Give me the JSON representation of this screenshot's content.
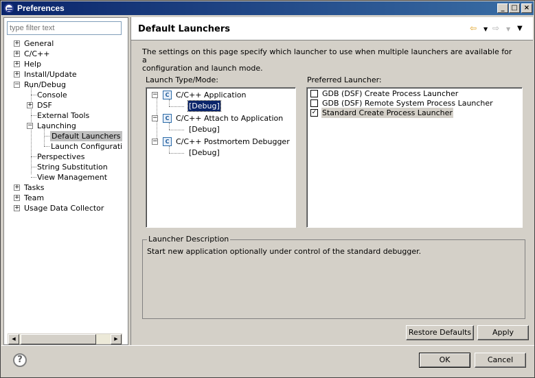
{
  "window": {
    "title": "Preferences"
  },
  "filter": {
    "placeholder": "type filter text"
  },
  "tree": {
    "items": [
      {
        "label": "General"
      },
      {
        "label": "C/C++"
      },
      {
        "label": "Help"
      },
      {
        "label": "Install/Update"
      },
      {
        "label": "Run/Debug"
      },
      {
        "label": "Console"
      },
      {
        "label": "DSF"
      },
      {
        "label": "External Tools"
      },
      {
        "label": "Launching"
      },
      {
        "label": "Default Launchers"
      },
      {
        "label": "Launch Configuratio"
      },
      {
        "label": "Perspectives"
      },
      {
        "label": "String Substitution"
      },
      {
        "label": "View Management"
      },
      {
        "label": "Tasks"
      },
      {
        "label": "Team"
      },
      {
        "label": "Usage Data Collector"
      }
    ]
  },
  "page": {
    "title": "Default Launchers",
    "description_line1": "The settings on this page specify which launcher to use when multiple launchers are available for a",
    "description_line2": "configuration and launch mode.",
    "launch_type_label": "Launch Type/Mode:",
    "preferred_label": "Preferred Launcher:",
    "launch_types": [
      {
        "name": "C/C++ Application",
        "mode": "[Debug]"
      },
      {
        "name": "C/C++ Attach to Application",
        "mode": "[Debug]"
      },
      {
        "name": "C/C++ Postmortem Debugger",
        "mode": "[Debug]"
      }
    ],
    "launchers": [
      {
        "label": "GDB (DSF) Create Process Launcher",
        "checked": false
      },
      {
        "label": "GDB (DSF) Remote System Process Launcher",
        "checked": false
      },
      {
        "label": "Standard Create Process Launcher",
        "checked": true
      }
    ],
    "description_group_label": "Launcher Description",
    "launcher_description": "Start new application optionally under control of the standard debugger.",
    "restore_defaults": "Restore Defaults",
    "apply": "Apply"
  },
  "footer": {
    "ok": "OK",
    "cancel": "Cancel",
    "help_glyph": "?"
  },
  "icons": {
    "c_project_letter": "C",
    "checkmark": "✓"
  }
}
